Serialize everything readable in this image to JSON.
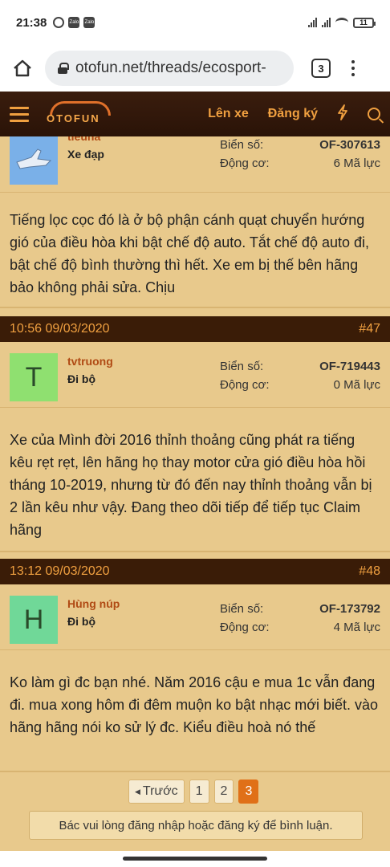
{
  "status": {
    "time": "21:38",
    "battery": "11",
    "badge1": "Zalo",
    "badge2": "Zalo"
  },
  "browser": {
    "url": "otofun.net/threads/ecosport-",
    "tab_count": "3"
  },
  "site": {
    "logo_text": "OTOFUN",
    "nav_login": "Lên xe",
    "nav_register": "Đăng ký"
  },
  "posts": [
    {
      "username": "tieuha",
      "rank": "Xe đạp",
      "plate_label": "Biển số:",
      "plate": "OF-307613",
      "engine_label": "Động cơ:",
      "engine": "6 Mã lực",
      "body": "Tiếng lọc cọc đó là ở bộ phận cánh quạt chuyển hướng gió của điều hòa khi bật chế độ auto. Tắt chế độ auto đi, bật chế độ bình thường thì hết. Xe em bị thế bên hãng bảo không phải sửa. Chịu"
    },
    {
      "datetime": "10:56 09/03/2020",
      "number": "#47",
      "avatar_letter": "T",
      "username": "tvtruong",
      "rank": "Đi bộ",
      "plate_label": "Biển số:",
      "plate": "OF-719443",
      "engine_label": "Động cơ:",
      "engine": "0 Mã lực",
      "body": "Xe của Mình đời 2016 thỉnh thoảng cũng phát ra tiếng kêu rẹt rẹt, lên hãng họ thay motor cửa gió điều hòa hồi tháng 10-2019, nhưng từ đó đến nay thỉnh thoảng vẫn bị 2 lần kêu như vậy. Đang theo dõi tiếp để tiếp tục Claim hãng"
    },
    {
      "datetime": "13:12 09/03/2020",
      "number": "#48",
      "avatar_letter": "H",
      "username": "Hùng núp",
      "rank": "Đi bộ",
      "plate_label": "Biển số:",
      "plate": "OF-173792",
      "engine_label": "Động cơ:",
      "engine": "4 Mã lực",
      "body": "Ko làm gì đc bạn nhé. Năm 2016 cậu e mua 1c vẫn đang đi. mua xong hôm đi đêm muộn ko bật nhạc mới biết. vào hãng hãng nói ko sử lý đc. Kiểu điều hoà nó thế"
    }
  ],
  "pagination": {
    "prev": "Trước",
    "pages": [
      "1",
      "2",
      "3"
    ],
    "current": "3"
  },
  "login_note": "Bác vui lòng đăng nhập hoặc đăng ký để bình luận."
}
